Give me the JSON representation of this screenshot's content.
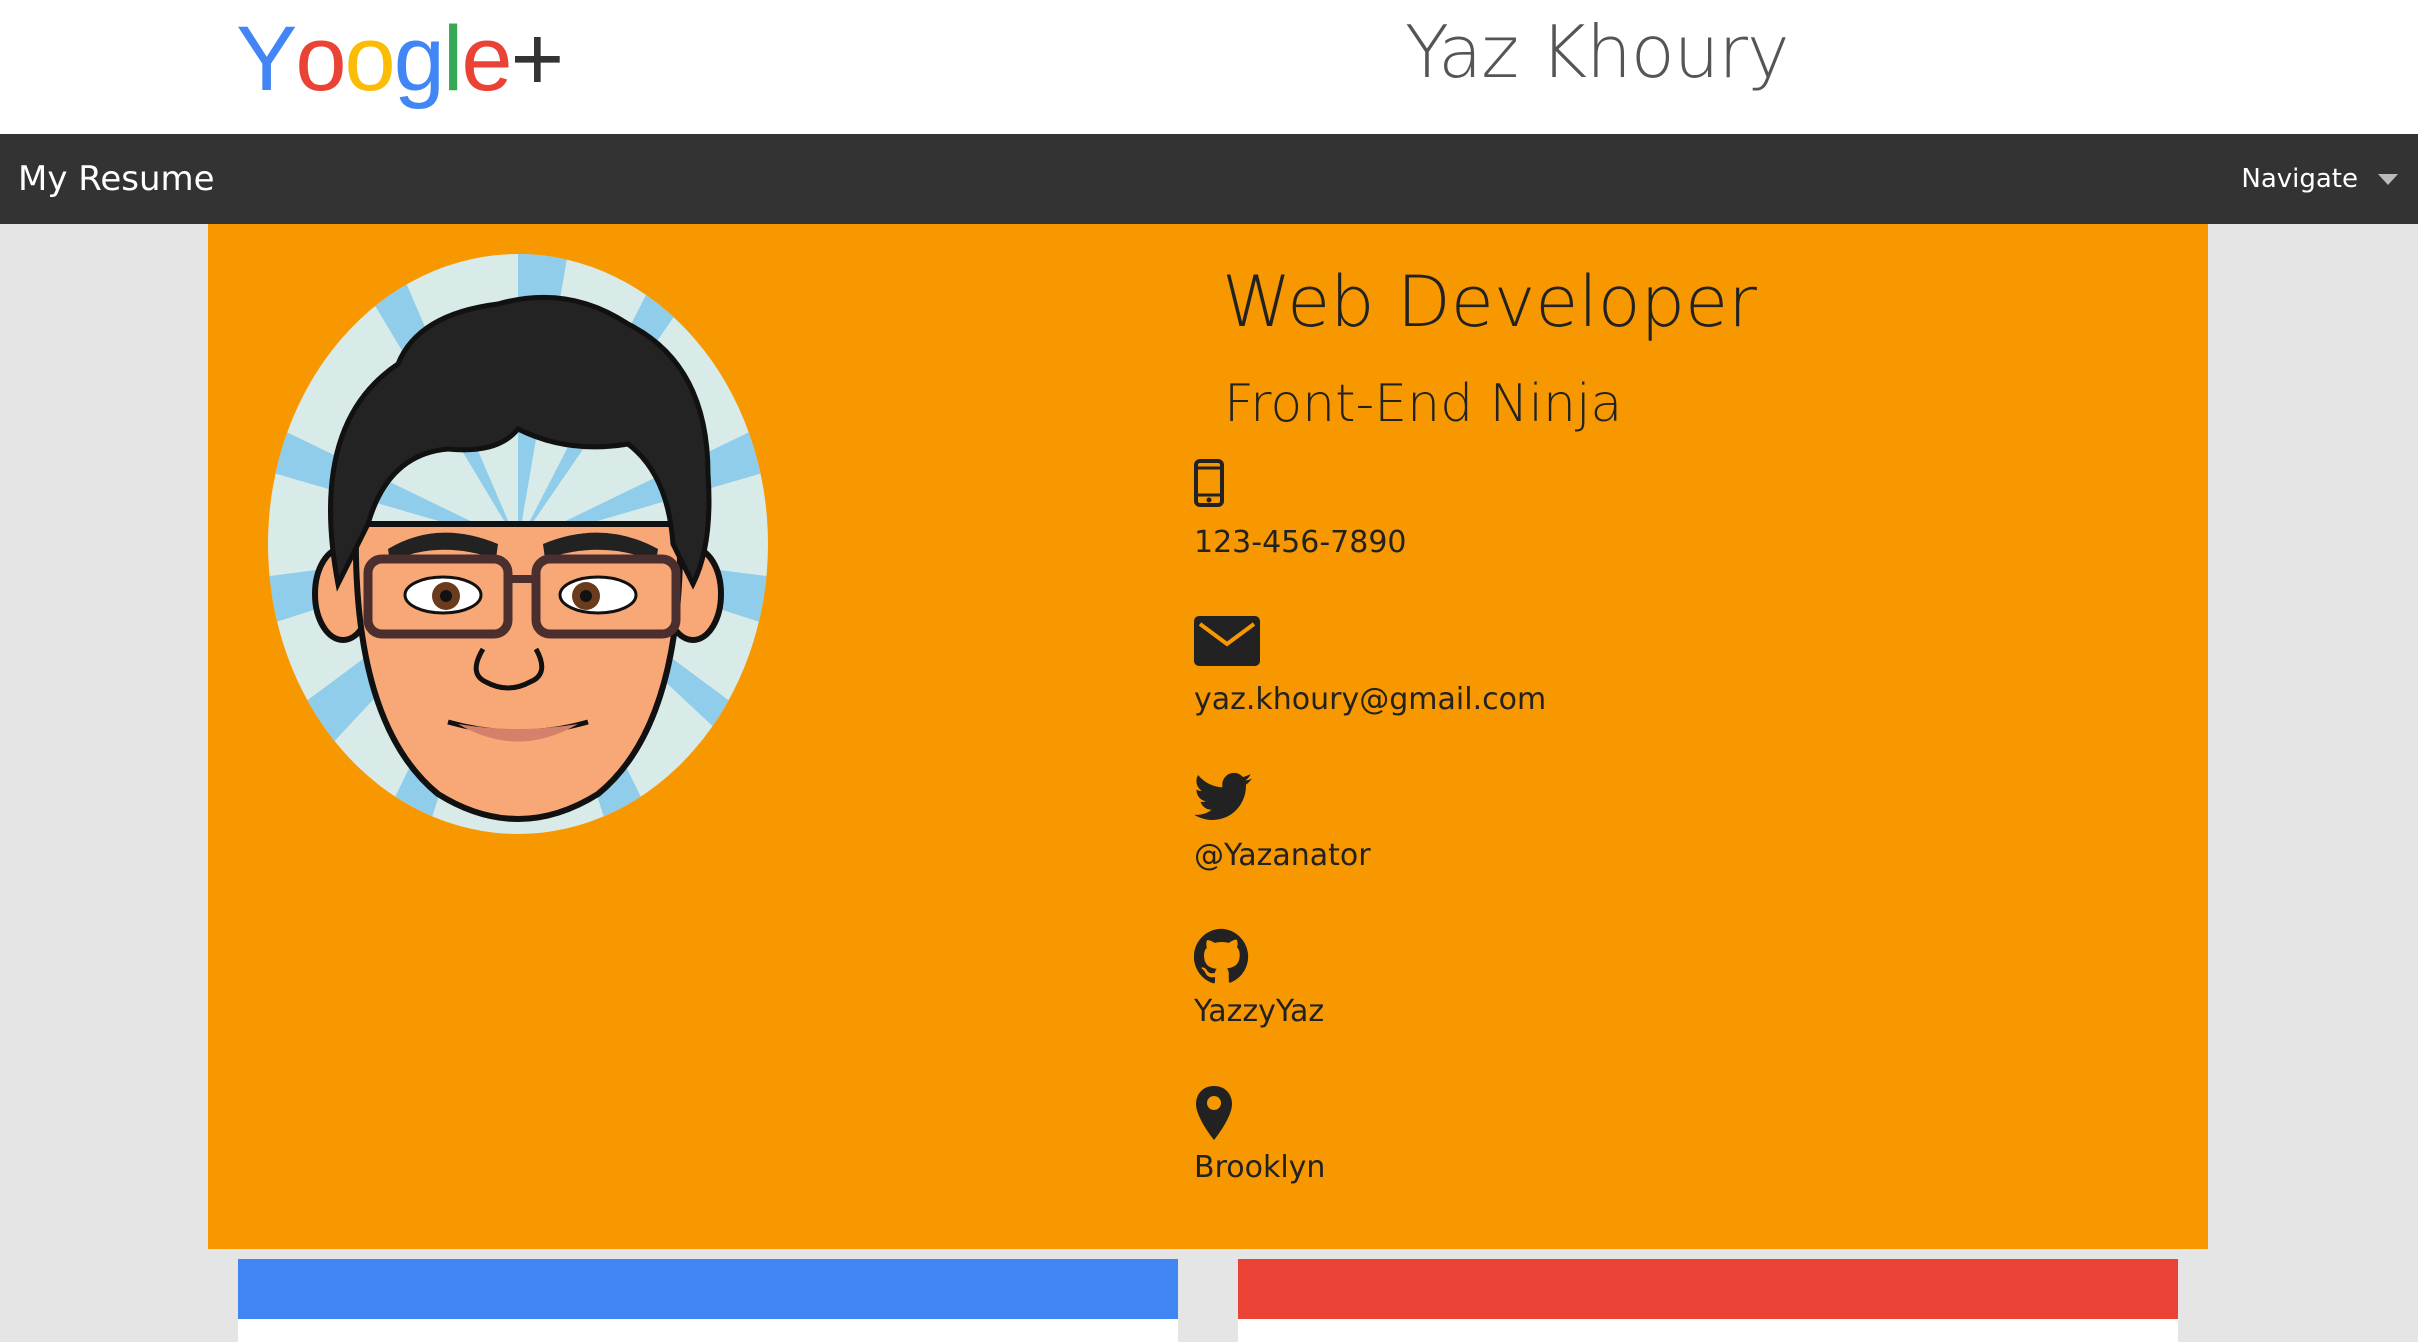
{
  "header": {
    "logo_letters": [
      "Y",
      "o",
      "o",
      "g",
      "l",
      "e",
      "+"
    ],
    "logo_colors": [
      "#4285f4",
      "#ea4335",
      "#fbbc05",
      "#4285f4",
      "#34a853",
      "#ea4335",
      "#333333"
    ],
    "site_title": "Yaz Khoury"
  },
  "navbar": {
    "brand": "My Resume",
    "dropdown_label": "Navigate",
    "background": "#333333"
  },
  "hero": {
    "background": "#f89800",
    "title": "Web Developer",
    "subtitle": "Front-End Ninja",
    "avatar_icon": "cartoon-avatar"
  },
  "contacts": [
    {
      "icon": "phone-icon",
      "value": "123-456-7890"
    },
    {
      "icon": "envelope-icon",
      "value": "yaz.khoury@gmail.com"
    },
    {
      "icon": "twitter-icon",
      "value": "@Yazanator"
    },
    {
      "icon": "github-icon",
      "value": "YazzyYaz"
    },
    {
      "icon": "map-marker-icon",
      "value": "Brooklyn"
    }
  ],
  "cards": [
    {
      "color": "#4285f4"
    },
    {
      "color": "#ea4335"
    }
  ]
}
